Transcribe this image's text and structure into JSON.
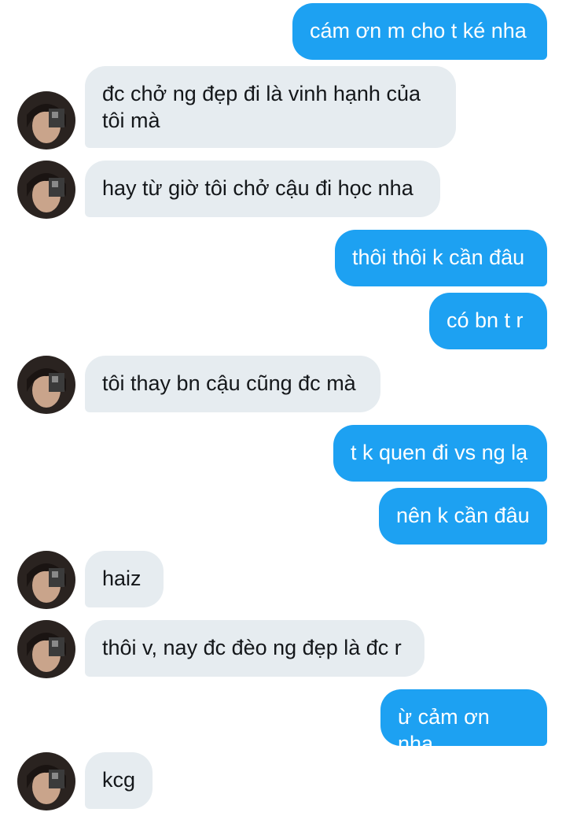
{
  "conversation": {
    "messages": [
      {
        "side": "out",
        "text": "cám ơn m cho t ké nha"
      },
      {
        "side": "in",
        "text": "đc chở ng đẹp đi là vinh hạnh của tôi mà"
      },
      {
        "side": "in",
        "text": "hay từ giờ tôi chở cậu đi học nha"
      },
      {
        "side": "out",
        "text": "thôi thôi k cần đâu"
      },
      {
        "side": "out",
        "text": "có bn t r"
      },
      {
        "side": "in",
        "text": "tôi thay bn cậu cũng đc mà"
      },
      {
        "side": "out",
        "text": "t k quen đi vs ng lạ"
      },
      {
        "side": "out",
        "text": "nên k cần đâu"
      },
      {
        "side": "in",
        "text": "haiz"
      },
      {
        "side": "in",
        "text": "thôi v, nay đc đèo ng đẹp là đc r"
      },
      {
        "side": "out",
        "text": "ừ cảm ơn nha"
      },
      {
        "side": "in",
        "text": "kcg"
      }
    ]
  },
  "colors": {
    "outgoing_bubble": "#1da1f2",
    "incoming_bubble": "#e6ecf0"
  },
  "icons": {
    "avatar": "contact-avatar-photo"
  }
}
